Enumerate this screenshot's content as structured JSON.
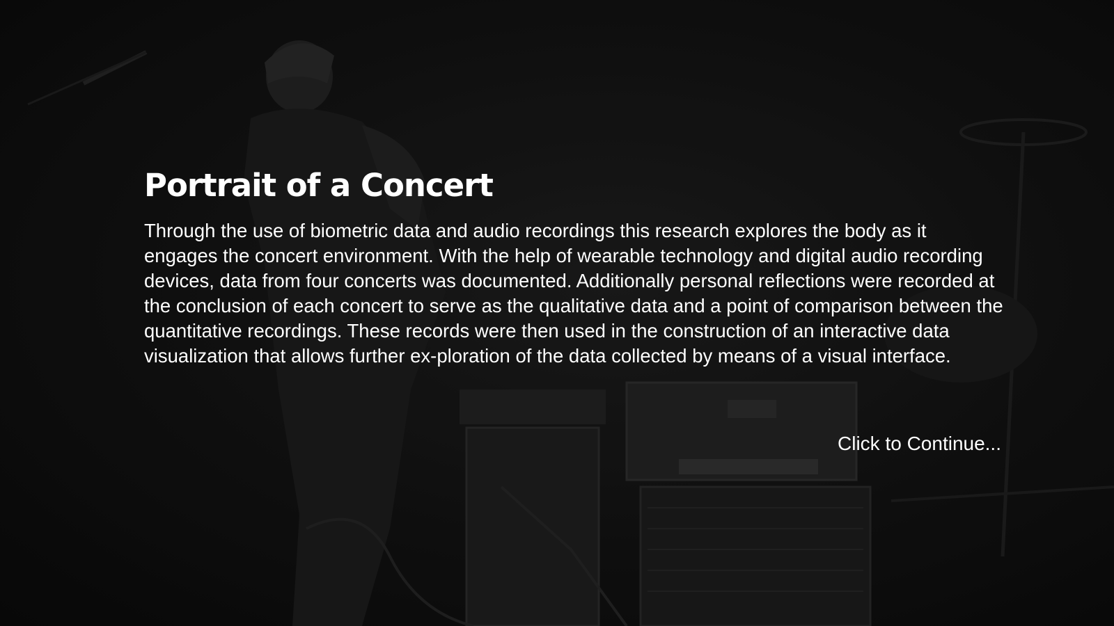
{
  "page": {
    "title": "Portrait of a Concert",
    "description": "Through the use of biometric data and audio recordings this research explores the body as it engages the concert environment. With the help of wearable technology and digital audio recording devices, data from four concerts was documented. Additionally personal reflections were recorded at the conclusion of each concert to serve as the qualitative data and a point of comparison between the quantitative recordings. These records were then used in the construction of an interactive data visualization that allows further ex-ploration of the data collected by means of a visual interface.",
    "continue_label": "Click to Continue..."
  },
  "colors": {
    "text": "#ffffff",
    "background": "#0b0b0b"
  }
}
